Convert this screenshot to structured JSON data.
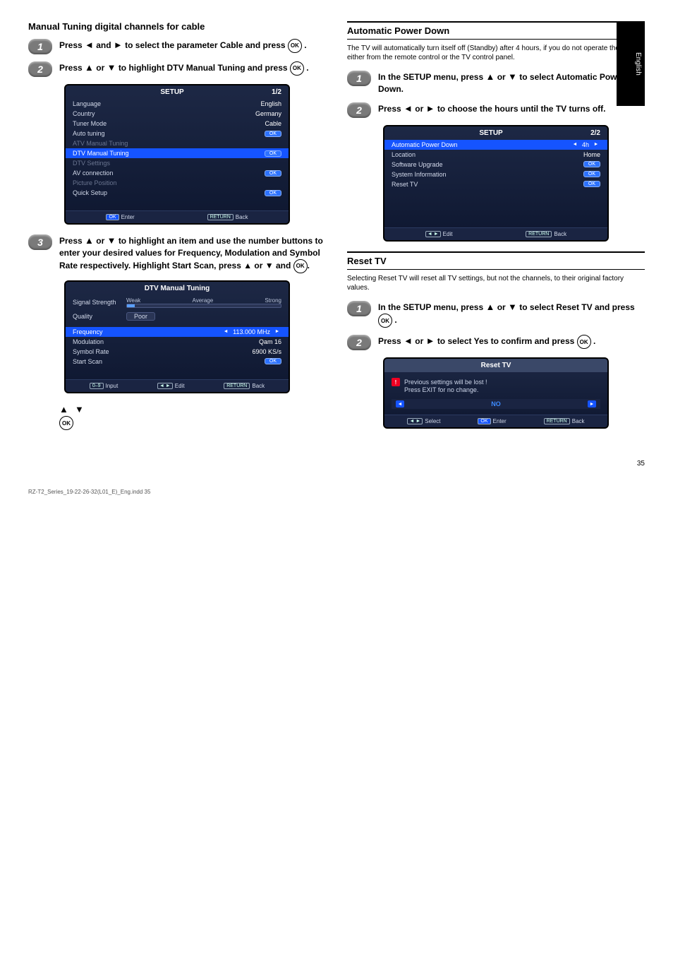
{
  "side_tab": "English",
  "left": {
    "heading": "Manual Tuning digital channels for cable",
    "step1": "Press ◄ and ► to select the parameter Cable and press .",
    "step2_a": "Press ▲ or ▼ to highlight DTV Manual Tuning and press .",
    "step2_b": "",
    "step3_a": "Press ▲ or ▼ to highlight an item and use the number buttons to enter your desired values for Frequency, Modulation and Symbol Rate respectively. Highlight Start Scan, press ▲ or ▼ and .",
    "osd1": {
      "title": "SETUP",
      "page": "1/2",
      "rows": [
        {
          "label": "Language",
          "val": "English"
        },
        {
          "label": "Country",
          "val": "Germany"
        },
        {
          "label": "Tuner Mode",
          "val": "Cable"
        },
        {
          "label": "Auto tuning",
          "val": "OK",
          "pill": true
        },
        {
          "label": "ATV Manual Tuning",
          "dim": true
        },
        {
          "label": "DTV Manual Tuning",
          "val": "OK",
          "pill": true,
          "sel": true
        },
        {
          "label": "DTV Settings",
          "dim": true
        },
        {
          "label": "AV connection",
          "val": "OK",
          "pill": true
        },
        {
          "label": "Picture Position",
          "dim": true
        },
        {
          "label": "Quick Setup",
          "val": "OK",
          "pill": true
        }
      ],
      "footer": {
        "enter": "Enter",
        "back": "Back"
      }
    },
    "osd2": {
      "title": "DTV Manual Tuning",
      "sig_label": "Signal Strength",
      "weak": "Weak",
      "avg": "Average",
      "strong": "Strong",
      "qual_label": "Quality",
      "qual_val": "Poor",
      "rows": [
        {
          "label": "Frequency",
          "val": "113.000 MHz",
          "sel": true,
          "arrows": true
        },
        {
          "label": "Modulation",
          "val": "Qam 16"
        },
        {
          "label": "Symbol Rate",
          "val": "6900 KS/s"
        },
        {
          "label": "Start Scan",
          "val": "OK",
          "pill": true
        }
      ],
      "footer": {
        "input": "Input",
        "edit": "Edit",
        "back": "Back",
        "numkey": "0–9"
      }
    }
  },
  "right": {
    "h1_title": "Automatic Power Down",
    "h1_sub": "The TV will automatically turn itself off (Standby) after 4 hours, if you do not operate the TV either from the remote control or the TV control panel.",
    "step1": "In the SETUP menu, press ▲ or ▼ to select Automatic Power Down.",
    "step2": "Press ◄ or ► to choose the hours until the TV turns off.",
    "osd3": {
      "title": "SETUP",
      "page": "2/2",
      "rows": [
        {
          "label": "Automatic Power Down",
          "val": "4h",
          "sel": true,
          "arrows": true
        },
        {
          "label": "Location",
          "val": "Home"
        },
        {
          "label": "Software Upgrade",
          "val": "OK",
          "pill": true
        },
        {
          "label": "System Information",
          "val": "OK",
          "pill": true
        },
        {
          "label": "Reset TV",
          "val": "OK",
          "pill": true
        }
      ],
      "footer": {
        "edit": "Edit",
        "back": "Back"
      }
    },
    "h2_title": "Reset TV",
    "h2_sub": "Selecting Reset TV will reset all TV settings, but not the channels, to their original factory values.",
    "step_r1": "In the SETUP menu, press ▲ or ▼ to select Reset TV and press .",
    "step_r2": "Press ◄ or ► to select Yes to confirm and press .",
    "reset": {
      "title": "Reset TV",
      "warn1": "Previous settings will be lost !",
      "warn2": "Press EXIT for no change.",
      "no": "NO",
      "footer": {
        "select": "Select",
        "enter": "Enter",
        "back": "Back"
      }
    }
  },
  "keys": {
    "ok": "OK",
    "return": "RETURN",
    "nav": "◄ ►"
  },
  "page_number": "35",
  "glossary": "RZ-T2_Series_19-22-26-32(L01_E)_Eng.indd   35"
}
